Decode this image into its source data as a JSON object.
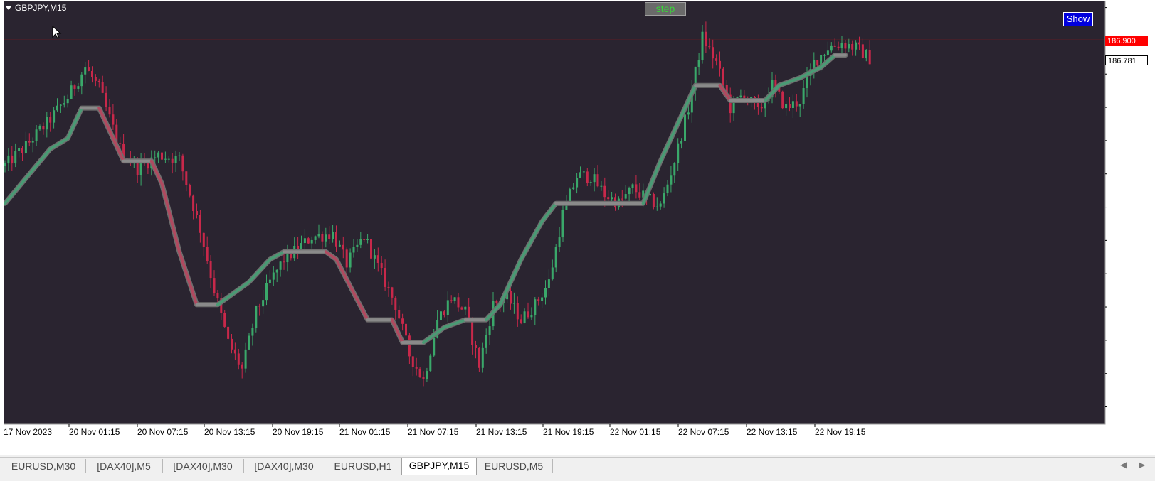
{
  "window": {
    "symbol_label": "GBPJPY,M15"
  },
  "buttons": {
    "step_label": "step",
    "show_label": "Show"
  },
  "price_tags": {
    "line_level": "186.900",
    "current_price": "186.781"
  },
  "colors": {
    "background": "#2a2430",
    "bull": "#3aa86a",
    "bear": "#c8284a",
    "line_level": "#ff0000",
    "trend_up": "#4a9a74",
    "trend_down": "#b04a60",
    "trend_flat": "#8a8a8a"
  },
  "chart_data": {
    "type": "candlestick",
    "title": "GBPJPY,M15",
    "y_ticks": [
      "187.115",
      "186.895",
      "186.675",
      "186.455",
      "186.235",
      "186.015",
      "185.795",
      "185.575",
      "185.355",
      "185.135",
      "184.915",
      "184.695",
      "184.475"
    ],
    "ylim": [
      184.36,
      187.16
    ],
    "x_ticks": [
      "17 Nov 2023",
      "20 Nov 01:15",
      "20 Nov 07:15",
      "20 Nov 13:15",
      "20 Nov 19:15",
      "21 Nov 01:15",
      "21 Nov 07:15",
      "21 Nov 13:15",
      "21 Nov 19:15",
      "22 Nov 01:15",
      "22 Nov 07:15",
      "22 Nov 13:15",
      "22 Nov 19:15"
    ],
    "horizontal_line": 186.9,
    "current_price": 186.781,
    "price_path": [
      [
        0,
        186.07
      ],
      [
        6,
        186.2
      ],
      [
        12,
        186.35
      ],
      [
        18,
        186.52
      ],
      [
        23,
        186.72
      ],
      [
        27,
        186.58
      ],
      [
        33,
        186.18
      ],
      [
        38,
        186.05
      ],
      [
        44,
        186.14
      ],
      [
        50,
        186.11
      ],
      [
        56,
        185.65
      ],
      [
        60,
        185.25
      ],
      [
        64,
        184.9
      ],
      [
        68,
        184.72
      ],
      [
        72,
        185.1
      ],
      [
        76,
        185.3
      ],
      [
        80,
        185.45
      ],
      [
        84,
        185.52
      ],
      [
        88,
        185.6
      ],
      [
        94,
        185.62
      ],
      [
        98,
        185.42
      ],
      [
        103,
        185.6
      ],
      [
        108,
        185.35
      ],
      [
        112,
        185.15
      ],
      [
        116,
        184.82
      ],
      [
        120,
        184.65
      ],
      [
        124,
        185.05
      ],
      [
        128,
        185.2
      ],
      [
        132,
        185.1
      ],
      [
        136,
        184.75
      ],
      [
        140,
        185.15
      ],
      [
        144,
        185.2
      ],
      [
        148,
        185.05
      ],
      [
        152,
        185.15
      ],
      [
        156,
        185.3
      ],
      [
        160,
        185.75
      ],
      [
        164,
        186.0
      ],
      [
        168,
        186.0
      ],
      [
        172,
        185.88
      ],
      [
        176,
        185.82
      ],
      [
        180,
        185.92
      ],
      [
        184,
        185.85
      ],
      [
        188,
        185.8
      ],
      [
        192,
        186.1
      ],
      [
        196,
        186.45
      ],
      [
        200,
        186.92
      ],
      [
        204,
        186.75
      ],
      [
        208,
        186.45
      ],
      [
        212,
        186.55
      ],
      [
        216,
        186.42
      ],
      [
        220,
        186.6
      ],
      [
        224,
        186.45
      ],
      [
        228,
        186.5
      ],
      [
        232,
        186.75
      ],
      [
        236,
        186.85
      ],
      [
        240,
        186.88
      ],
      [
        244,
        186.85
      ],
      [
        248,
        186.78
      ]
    ],
    "trend_line": [
      [
        0,
        185.82
      ],
      [
        13,
        186.18
      ],
      [
        18,
        186.25
      ],
      [
        22,
        186.45
      ],
      [
        27,
        186.45
      ],
      [
        30,
        186.3
      ],
      [
        34,
        186.1
      ],
      [
        42,
        186.1
      ],
      [
        45,
        185.95
      ],
      [
        50,
        185.5
      ],
      [
        55,
        185.15
      ],
      [
        61,
        185.15
      ],
      [
        64,
        185.2
      ],
      [
        70,
        185.3
      ],
      [
        76,
        185.45
      ],
      [
        80,
        185.5
      ],
      [
        92,
        185.5
      ],
      [
        95,
        185.45
      ],
      [
        104,
        185.05
      ],
      [
        111,
        185.05
      ],
      [
        114,
        184.9
      ],
      [
        120,
        184.9
      ],
      [
        126,
        185.0
      ],
      [
        132,
        185.05
      ],
      [
        138,
        185.05
      ],
      [
        142,
        185.15
      ],
      [
        148,
        185.45
      ],
      [
        154,
        185.7
      ],
      [
        158,
        185.82
      ],
      [
        174,
        185.82
      ],
      [
        178,
        185.82
      ],
      [
        183,
        185.82
      ],
      [
        188,
        186.1
      ],
      [
        194,
        186.4
      ],
      [
        198,
        186.6
      ],
      [
        205,
        186.6
      ],
      [
        208,
        186.5
      ],
      [
        218,
        186.5
      ],
      [
        222,
        186.6
      ],
      [
        228,
        186.65
      ],
      [
        234,
        186.72
      ],
      [
        238,
        186.8
      ],
      [
        241,
        186.8
      ]
    ]
  },
  "tabs": [
    "EURUSD,M30",
    "[DAX40],M5",
    "[DAX40],M30",
    "[DAX40],M30",
    "EURUSD,H1",
    "GBPJPY,M15",
    "EURUSD,M5"
  ],
  "active_tab": "GBPJPY,M15",
  "nav": {
    "left": "◀",
    "right": "▶"
  }
}
